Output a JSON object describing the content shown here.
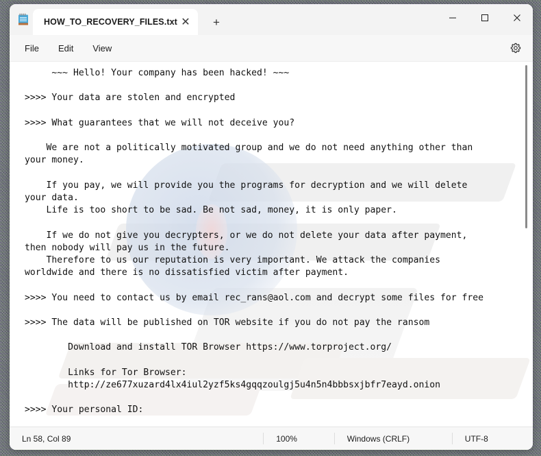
{
  "window": {
    "app_icon": "notepad-icon",
    "controls": {
      "minimize": "—",
      "maximize": "□",
      "close": "✕"
    }
  },
  "tab": {
    "title": "HOW_TO_RECOVERY_FILES.txt",
    "close_glyph": "✕",
    "new_tab_glyph": "+"
  },
  "menubar": {
    "items": [
      {
        "label": "File"
      },
      {
        "label": "Edit"
      },
      {
        "label": "View"
      }
    ],
    "settings_icon": "gear-icon"
  },
  "editor": {
    "content": "     ~~~ Hello! Your company has been hacked! ~~~\n\n>>>> Your data are stolen and encrypted\n\n>>>> What guarantees that we will not deceive you?\n\n    We are not a politically motivated group and we do not need anything other than\nyour money.\n\n    If you pay, we will provide you the programs for decryption and we will delete\nyour data.\n    Life is too short to be sad. Be not sad, money, it is only paper.\n\n    If we do not give you decrypters, or we do not delete your data after payment,\nthen nobody will pay us in the future.\n    Therefore to us our reputation is very important. We attack the companies\nworldwide and there is no dissatisfied victim after payment.\n\n>>>> You need to contact us by email rec_rans@aol.com and decrypt some files for free\n\n>>>> The data will be published on TOR website if you do not pay the ransom\n\n        Download and install TOR Browser https://www.torproject.org/\n\n        Links for Tor Browser:\n        http://ze677xuzard4lx4iul2yzf5ks4gqqzoulgj5u4n5n4bbbsxjbfr7eayd.onion\n\n>>>> Your personal ID:"
  },
  "statusbar": {
    "line_col": "Ln 58, Col 89",
    "zoom": "100%",
    "line_ending": "Windows (CRLF)",
    "encoding": "UTF-8"
  },
  "colors": {
    "window_bg": "#f7f7f7",
    "editor_bg": "#ffffff",
    "tab_active_bg": "#ffffff",
    "text": "#111111",
    "close_hover": "#e81123"
  }
}
